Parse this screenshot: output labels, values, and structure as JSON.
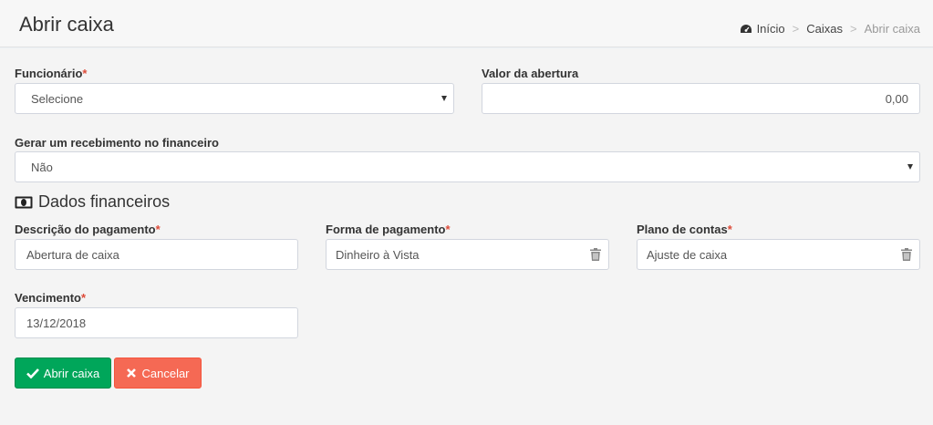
{
  "header": {
    "title": "Abrir caixa",
    "breadcrumb": {
      "home": "Início",
      "section": "Caixas",
      "current": "Abrir caixa",
      "separator": ">"
    }
  },
  "form": {
    "funcionario": {
      "label": "Funcionário",
      "required": "*",
      "value": "Selecione"
    },
    "valor_abertura": {
      "label": "Valor da abertura",
      "value": "0,00"
    },
    "gerar_recebimento": {
      "label": "Gerar um recebimento no financeiro",
      "value": "Não"
    },
    "section_financeiros": {
      "title": "Dados financeiros",
      "icon": "money-icon"
    },
    "descricao": {
      "label": "Descrição do pagamento",
      "required": "*",
      "value": "Abertura de caixa"
    },
    "forma_pagamento": {
      "label": "Forma de pagamento",
      "required": "*",
      "value": "Dinheiro à Vista"
    },
    "plano_contas": {
      "label": "Plano de contas",
      "required": "*",
      "value": "Ajuste de caixa"
    },
    "vencimento": {
      "label": "Vencimento",
      "required": "*",
      "value": "13/12/2018"
    }
  },
  "buttons": {
    "abrir": {
      "label": "Abrir caixa",
      "icon": "check-icon",
      "color": "#00a65a"
    },
    "cancelar": {
      "label": "Cancelar",
      "icon": "times-icon",
      "color": "#f56954"
    }
  },
  "colors": {
    "required": "#dd4b39",
    "background": "#f4f4f4"
  }
}
